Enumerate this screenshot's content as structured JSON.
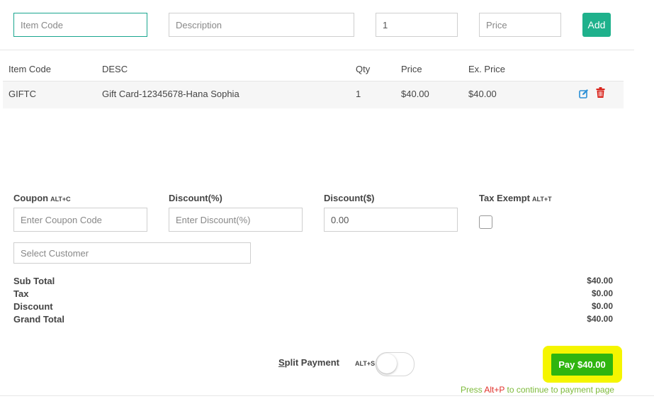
{
  "entry": {
    "item_code_placeholder": "Item Code",
    "description_placeholder": "Description",
    "qty_value": "1",
    "price_placeholder": "Price",
    "add_label": "Add"
  },
  "table": {
    "headers": [
      "Item Code",
      "DESC",
      "Qty",
      "Price",
      "Ex. Price"
    ],
    "rows": [
      {
        "code": "GIFTC",
        "desc": "Gift Card-12345678-Hana Sophia",
        "qty": "1",
        "price": "$40.00",
        "ex_price": "$40.00",
        "actions": [
          "edit-icon",
          "trash-icon"
        ]
      }
    ]
  },
  "discounts": {
    "coupon_label": "Coupon",
    "coupon_shortcut": "ALT+C",
    "coupon_placeholder": "Enter Coupon Code",
    "discount_pct_label": "Discount(%)",
    "discount_pct_placeholder": "Enter Discount(%)",
    "discount_amt_label": "Discount($)",
    "discount_amt_value": "0.00",
    "tax_exempt_label": "Tax Exempt",
    "tax_exempt_shortcut": "ALT+T",
    "customer_placeholder": "Select Customer"
  },
  "totals": {
    "sub_total_label": "Sub Total",
    "sub_total": "$40.00",
    "tax_label": "Tax",
    "tax": "$0.00",
    "discount_label": "Discount",
    "discount": "$0.00",
    "grand_total_label": "Grand Total",
    "grand_total": "$40.00"
  },
  "footer": {
    "split_first": "S",
    "split_rest": "plit Payment",
    "split_shortcut": "ALT+S",
    "pay_label": "Pay $40.00",
    "hint_pre": "Press ",
    "hint_key": "Alt+P",
    "hint_post": " to continue to payment page"
  },
  "colors": {
    "accent": "#1fb18c",
    "pay": "#2fb50f",
    "highlight": "#f5f500",
    "hint": "#7dba3a",
    "hint_key": "#e0302a",
    "delete": "#d9241c",
    "edit": "#2a8fd6"
  }
}
